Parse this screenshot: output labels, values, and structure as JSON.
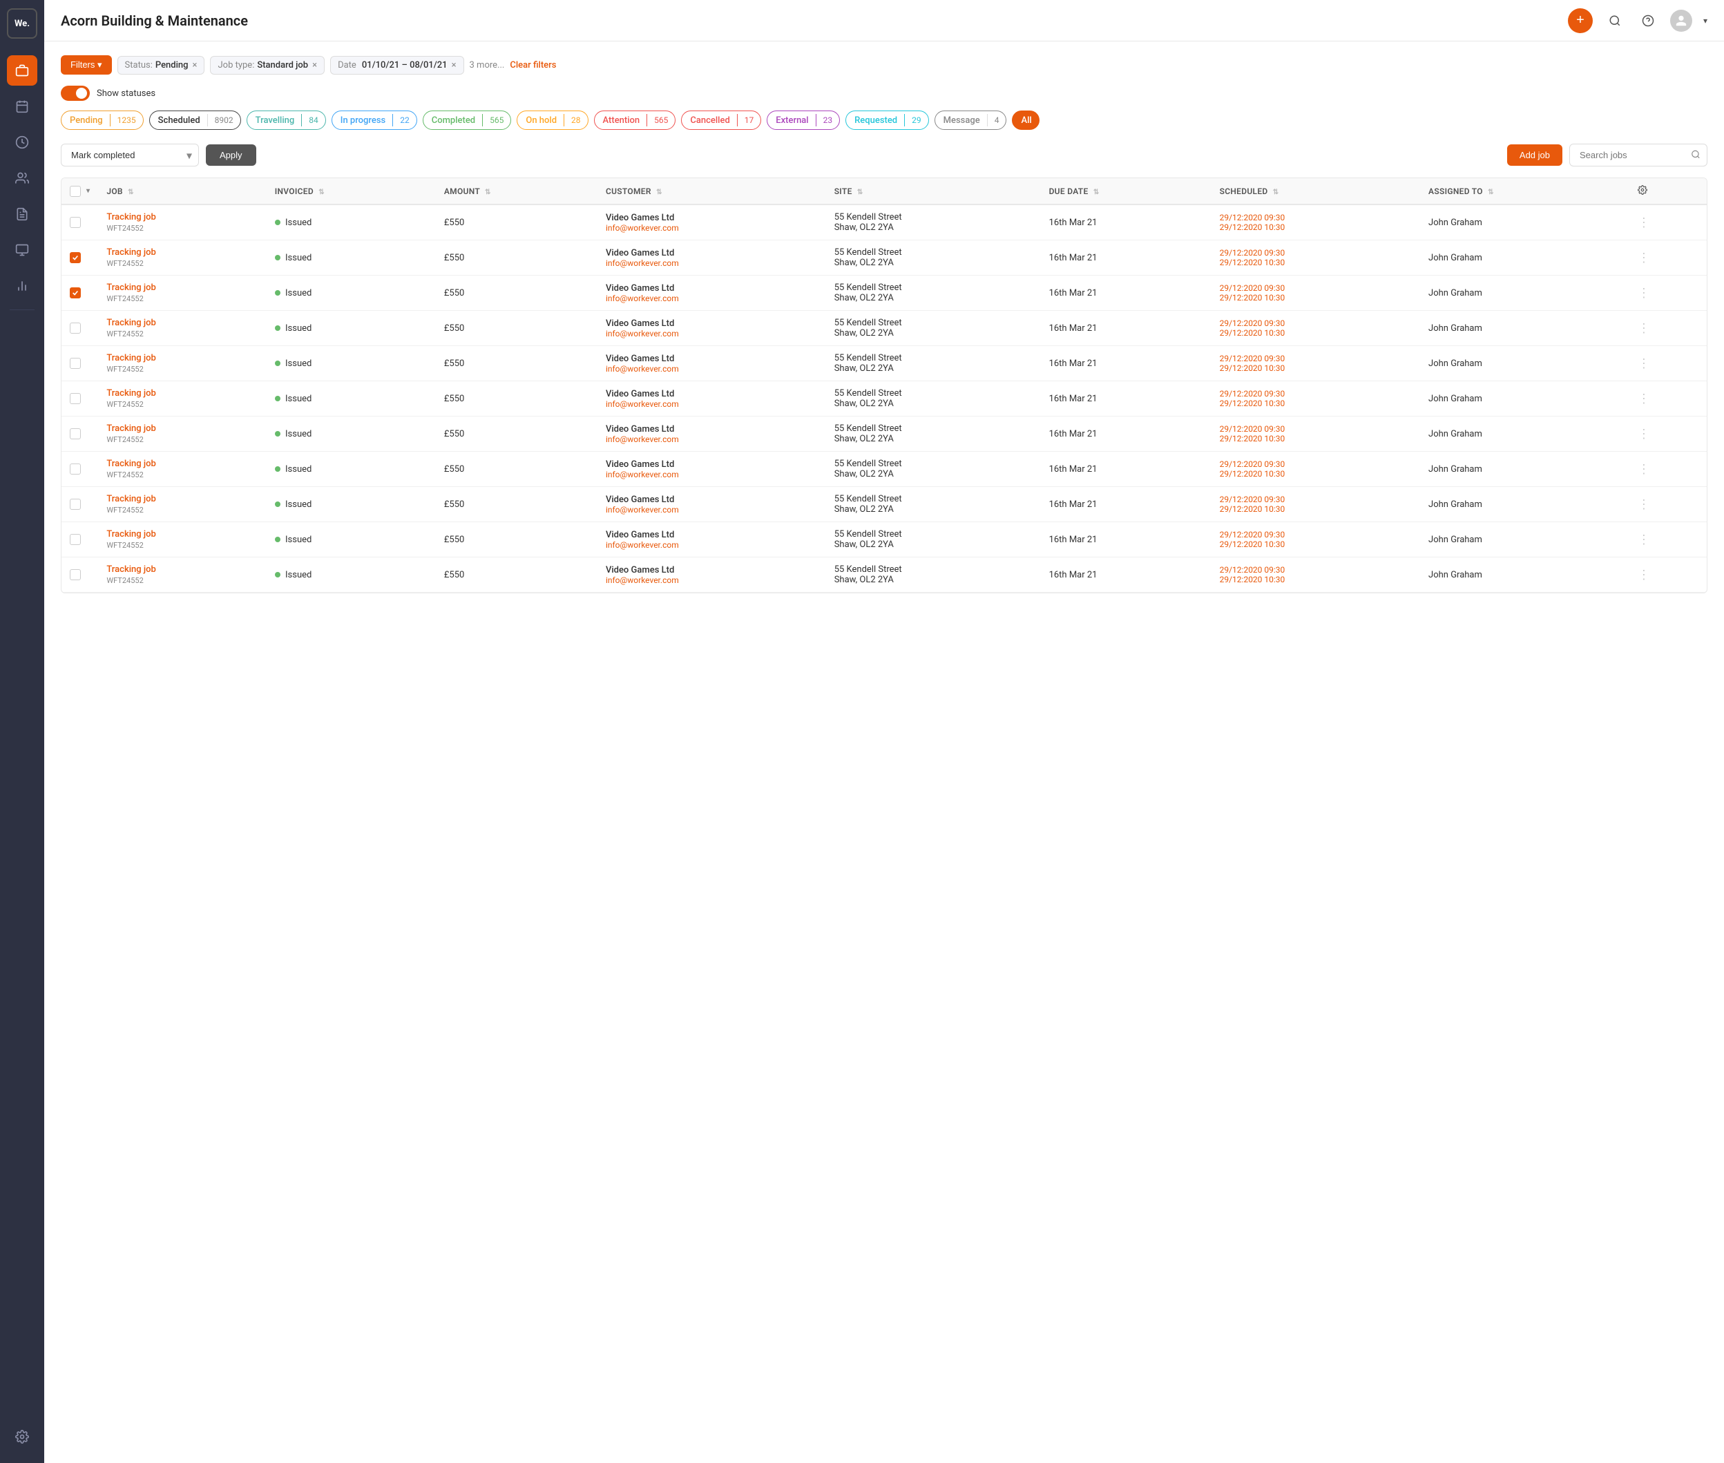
{
  "app": {
    "logo": "We.",
    "title": "Acorn Building & Maintenance"
  },
  "sidebar": {
    "items": [
      {
        "name": "briefcase",
        "icon": "💼",
        "active": true
      },
      {
        "name": "calendar",
        "icon": "📅",
        "active": false
      },
      {
        "name": "clock",
        "icon": "🕐",
        "active": false
      },
      {
        "name": "users",
        "icon": "👥",
        "active": false
      },
      {
        "name": "document",
        "icon": "📄",
        "active": false
      },
      {
        "name": "chart",
        "icon": "📊",
        "active": false
      }
    ]
  },
  "filters": {
    "btn_label": "Filters ▾",
    "chips": [
      {
        "label": "Status:",
        "value": "Pending",
        "has_close": true
      },
      {
        "label": "Job type:",
        "value": "Standard job",
        "has_close": true
      },
      {
        "label": "Date",
        "value": "01/10/21 – 08/01/21",
        "has_close": true
      }
    ],
    "more_label": "3 more...",
    "clear_label": "Clear filters"
  },
  "statuses_toggle": {
    "label": "Show statuses",
    "on": true
  },
  "status_chips": [
    {
      "id": "pending",
      "label": "Pending",
      "count": "1235",
      "color_class": "chip-pending"
    },
    {
      "id": "scheduled",
      "label": "Scheduled",
      "count": "8902",
      "color_class": "chip-scheduled"
    },
    {
      "id": "travelling",
      "label": "Travelling",
      "count": "84",
      "color_class": "chip-travelling"
    },
    {
      "id": "inprogress",
      "label": "In progress",
      "count": "22",
      "color_class": "chip-inprogress"
    },
    {
      "id": "completed",
      "label": "Completed",
      "count": "565",
      "color_class": "chip-completed"
    },
    {
      "id": "onhold",
      "label": "On hold",
      "count": "28",
      "color_class": "chip-onhold"
    },
    {
      "id": "attention",
      "label": "Attention",
      "count": "565",
      "color_class": "chip-attention"
    },
    {
      "id": "cancelled",
      "label": "Cancelled",
      "count": "17",
      "color_class": "chip-cancelled"
    },
    {
      "id": "external",
      "label": "External",
      "count": "23",
      "color_class": "chip-external"
    },
    {
      "id": "requested",
      "label": "Requested",
      "count": "29",
      "color_class": "chip-requested"
    },
    {
      "id": "message",
      "label": "Message",
      "count": "4",
      "color_class": "chip-message"
    },
    {
      "id": "all",
      "label": "All",
      "count": "",
      "color_class": "chip-all",
      "active": true
    }
  ],
  "action_bar": {
    "select_placeholder": "Mark completed",
    "apply_label": "Apply",
    "add_job_label": "Add job",
    "search_placeholder": "Search jobs"
  },
  "table": {
    "columns": [
      "",
      "JOB",
      "INVOICED",
      "AMOUNT",
      "CUSTOMER",
      "SITE",
      "DUE DATE",
      "SCHEDULED",
      "ASSIGNED TO",
      "⚙"
    ],
    "rows": [
      {
        "checked": false,
        "job_name": "Tracking job",
        "job_id": "WFT24552",
        "invoiced": "Issued",
        "amount": "£550",
        "customer_name": "Video Games Ltd",
        "customer_email": "info@workever.com",
        "site": "55  Kendell Street",
        "site2": "Shaw, OL2 2YA",
        "due_date": "16th Mar 21",
        "scheduled1": "29/12:2020 09:30",
        "scheduled2": "29/12:2020 10:30",
        "assigned": "John Graham"
      },
      {
        "checked": true,
        "job_name": "Tracking job",
        "job_id": "WFT24552",
        "invoiced": "Issued",
        "amount": "£550",
        "customer_name": "Video Games Ltd",
        "customer_email": "info@workever.com",
        "site": "55  Kendell Street",
        "site2": "Shaw, OL2 2YA",
        "due_date": "16th Mar 21",
        "scheduled1": "29/12:2020 09:30",
        "scheduled2": "29/12:2020 10:30",
        "assigned": "John Graham"
      },
      {
        "checked": true,
        "job_name": "Tracking job",
        "job_id": "WFT24552",
        "invoiced": "Issued",
        "amount": "£550",
        "customer_name": "Video Games Ltd",
        "customer_email": "info@workever.com",
        "site": "55  Kendell Street",
        "site2": "Shaw, OL2 2YA",
        "due_date": "16th Mar 21",
        "scheduled1": "29/12:2020 09:30",
        "scheduled2": "29/12:2020 10:30",
        "assigned": "John Graham"
      },
      {
        "checked": false,
        "job_name": "Tracking job",
        "job_id": "WFT24552",
        "invoiced": "Issued",
        "amount": "£550",
        "customer_name": "Video Games Ltd",
        "customer_email": "info@workever.com",
        "site": "55  Kendell Street",
        "site2": "Shaw, OL2 2YA",
        "due_date": "16th Mar 21",
        "scheduled1": "29/12:2020 09:30",
        "scheduled2": "29/12:2020 10:30",
        "assigned": "John Graham"
      },
      {
        "checked": false,
        "job_name": "Tracking job",
        "job_id": "WFT24552",
        "invoiced": "Issued",
        "amount": "£550",
        "customer_name": "Video Games Ltd",
        "customer_email": "info@workever.com",
        "site": "55  Kendell Street",
        "site2": "Shaw, OL2 2YA",
        "due_date": "16th Mar 21",
        "scheduled1": "29/12:2020 09:30",
        "scheduled2": "29/12:2020 10:30",
        "assigned": "John Graham"
      },
      {
        "checked": false,
        "job_name": "Tracking job",
        "job_id": "WFT24552",
        "invoiced": "Issued",
        "amount": "£550",
        "customer_name": "Video Games Ltd",
        "customer_email": "info@workever.com",
        "site": "55  Kendell Street",
        "site2": "Shaw, OL2 2YA",
        "due_date": "16th Mar 21",
        "scheduled1": "29/12:2020 09:30",
        "scheduled2": "29/12:2020 10:30",
        "assigned": "John Graham"
      },
      {
        "checked": false,
        "job_name": "Tracking job",
        "job_id": "WFT24552",
        "invoiced": "Issued",
        "amount": "£550",
        "customer_name": "Video Games Ltd",
        "customer_email": "info@workever.com",
        "site": "55  Kendell Street",
        "site2": "Shaw, OL2 2YA",
        "due_date": "16th Mar 21",
        "scheduled1": "29/12:2020 09:30",
        "scheduled2": "29/12:2020 10:30",
        "assigned": "John Graham"
      },
      {
        "checked": false,
        "job_name": "Tracking job",
        "job_id": "WFT24552",
        "invoiced": "Issued",
        "amount": "£550",
        "customer_name": "Video Games Ltd",
        "customer_email": "info@workever.com",
        "site": "55  Kendell Street",
        "site2": "Shaw, OL2 2YA",
        "due_date": "16th Mar 21",
        "scheduled1": "29/12:2020 09:30",
        "scheduled2": "29/12:2020 10:30",
        "assigned": "John Graham"
      },
      {
        "checked": false,
        "job_name": "Tracking job",
        "job_id": "WFT24552",
        "invoiced": "Issued",
        "amount": "£550",
        "customer_name": "Video Games Ltd",
        "customer_email": "info@workever.com",
        "site": "55  Kendell Street",
        "site2": "Shaw, OL2 2YA",
        "due_date": "16th Mar 21",
        "scheduled1": "29/12:2020 09:30",
        "scheduled2": "29/12:2020 10:30",
        "assigned": "John Graham"
      },
      {
        "checked": false,
        "job_name": "Tracking job",
        "job_id": "WFT24552",
        "invoiced": "Issued",
        "amount": "£550",
        "customer_name": "Video Games Ltd",
        "customer_email": "info@workever.com",
        "site": "55  Kendell Street",
        "site2": "Shaw, OL2 2YA",
        "due_date": "16th Mar 21",
        "scheduled1": "29/12:2020 09:30",
        "scheduled2": "29/12:2020 10:30",
        "assigned": "John Graham"
      },
      {
        "checked": false,
        "job_name": "Tracking job",
        "job_id": "WFT24552",
        "invoiced": "Issued",
        "amount": "£550",
        "customer_name": "Video Games Ltd",
        "customer_email": "info@workever.com",
        "site": "55  Kendell Street",
        "site2": "Shaw, OL2 2YA",
        "due_date": "16th Mar 21",
        "scheduled1": "29/12:2020 09:30",
        "scheduled2": "29/12:2020 10:30",
        "assigned": "John Graham"
      }
    ]
  }
}
